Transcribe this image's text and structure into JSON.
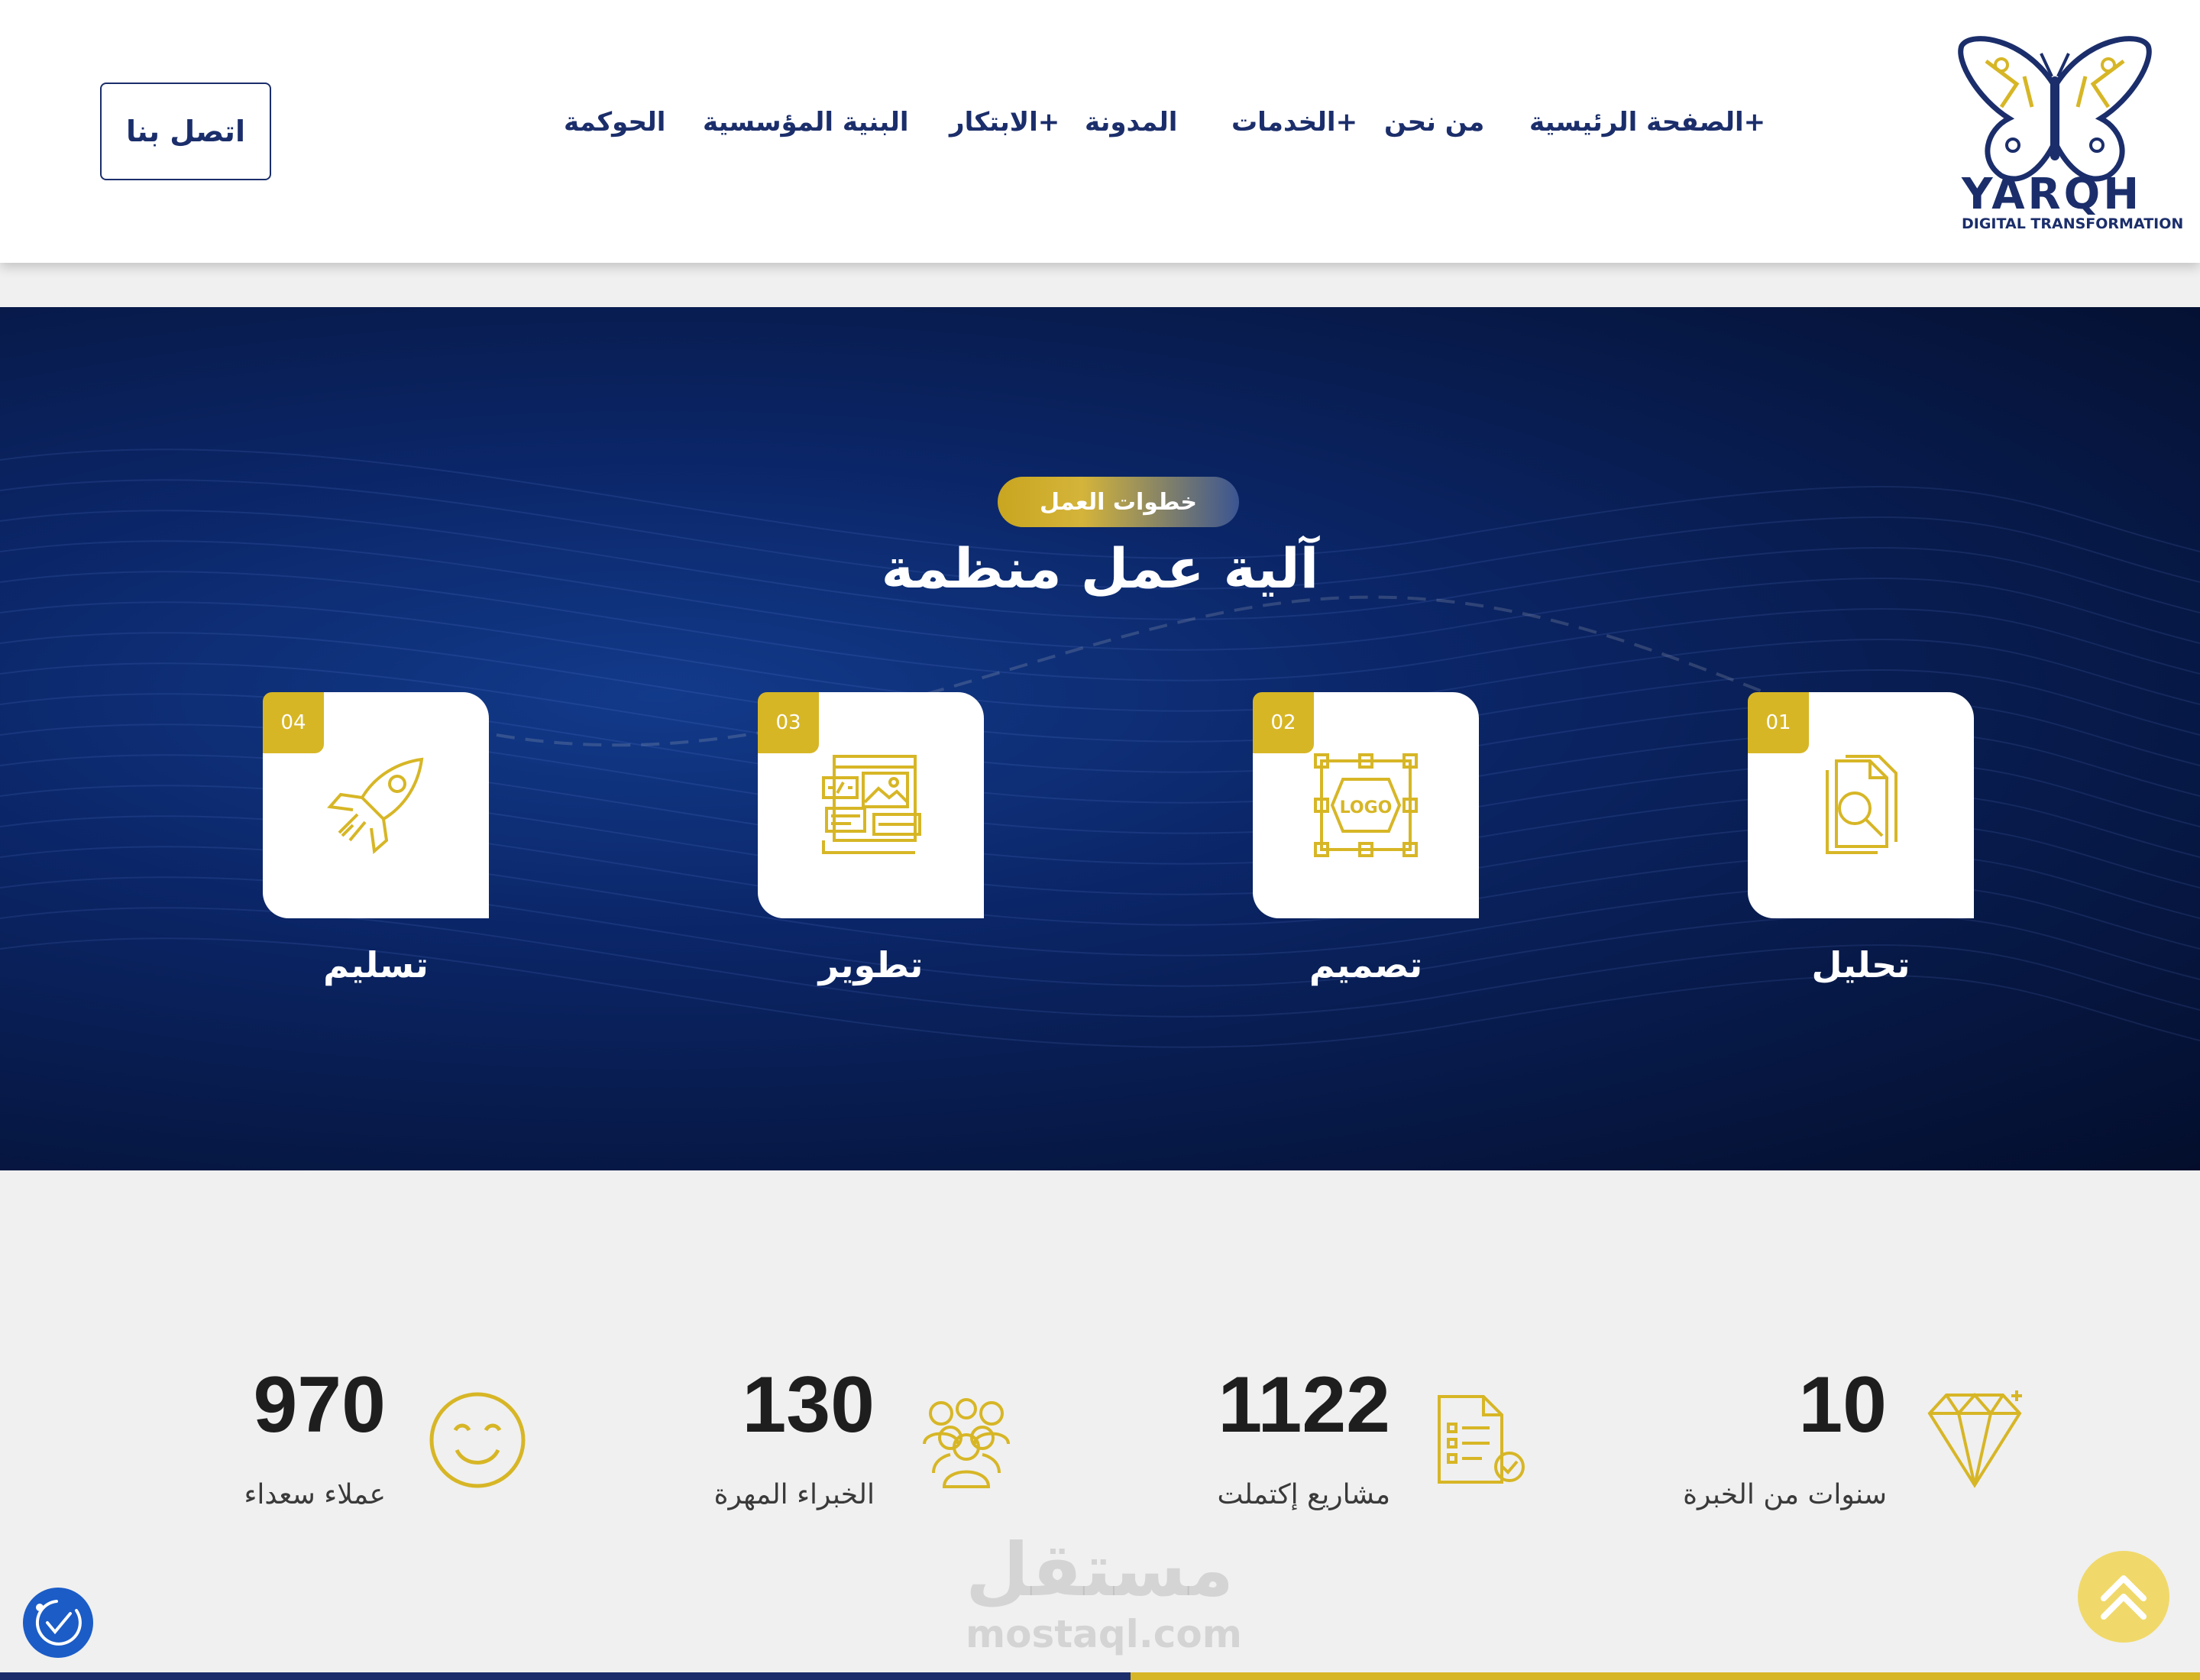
{
  "brand": {
    "name": "YARQH",
    "tagline": "DIGITAL TRANSFORMATION",
    "navy": "#1b2e6b",
    "gold": "#d7b626"
  },
  "nav": {
    "items": [
      {
        "label": "الصفحة الرئيسية+"
      },
      {
        "label": "من نحن"
      },
      {
        "label": "الخدمات+"
      },
      {
        "label": "المدونة"
      },
      {
        "label": "الابتكار+"
      },
      {
        "label": "البنية المؤسسية"
      },
      {
        "label": "الحوكمة"
      }
    ],
    "contact_label": "اتصل بنا"
  },
  "process": {
    "badge": "خطوات العمل",
    "title": "آلية عمل منظمة",
    "steps": [
      {
        "number": "01",
        "label": "تحليل",
        "icon": "document-search-icon"
      },
      {
        "number": "02",
        "label": "تصميم",
        "icon": "logo-design-icon"
      },
      {
        "number": "03",
        "label": "تطوير",
        "icon": "web-development-icon"
      },
      {
        "number": "04",
        "label": "تسليم",
        "icon": "rocket-icon"
      }
    ]
  },
  "stats": [
    {
      "value": "10",
      "label": "سنوات من الخبرة",
      "icon": "diamond-icon"
    },
    {
      "value": "1122",
      "label": "مشاريع إكتملت",
      "icon": "checklist-icon"
    },
    {
      "value": "130",
      "label": "الخبراء المهرة",
      "icon": "team-icon"
    },
    {
      "value": "970",
      "label": "عملاء سعداء",
      "icon": "smiley-icon"
    }
  ],
  "watermark": {
    "arabic": "مستقل",
    "latin": "mostaql.com"
  }
}
